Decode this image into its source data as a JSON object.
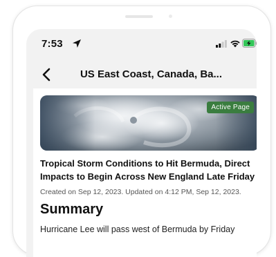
{
  "status_bar": {
    "time": "7:53",
    "icons": [
      "location-arrow-icon",
      "signal-icon",
      "wifi-icon",
      "battery-charging-icon"
    ],
    "battery_color": "#34c759"
  },
  "nav_bar": {
    "back_icon": "chevron-left-icon",
    "title": "US East Coast, Canada, Ba..."
  },
  "article": {
    "hero_image": "hurricane-satellite-image",
    "badge": "Active Page",
    "badge_color": "#3a7d3f",
    "headline": "Tropical Storm Conditions to Hit Bermuda, Direct Impacts to Begin Across New England Late Friday",
    "meta": "Created on Sep 12, 2023. Updated on 4:12 PM, Sep 12, 2023.",
    "section_title": "Summary",
    "body": "Hurricane Lee will pass west of Bermuda by Friday"
  }
}
